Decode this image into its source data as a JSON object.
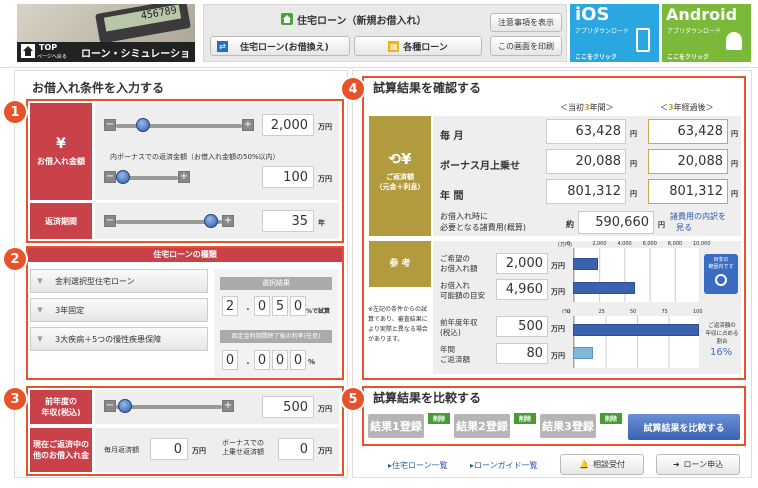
{
  "header": {
    "logo_top": "TOP",
    "logo_back": "ページへ戻る",
    "logo_title": "ローン・シミュレーション",
    "main_title": "住宅ローン（新規お借入れ）",
    "tab1": "住宅ローン(お借換え)",
    "tab2": "各種ローン",
    "btn_notes": "注意事項を表示",
    "btn_print": "この画面を印刷",
    "ios_title": "iOS",
    "ios_sub": "アプリダウンロード",
    "ios_click": "ここをクリック",
    "android_title": "Android",
    "android_sub": "アプリダウンロード",
    "android_click": "ここをクリック"
  },
  "left": {
    "title": "お借入れ条件を入力する",
    "yen": "¥",
    "loan_amount_label": "お借入れ金額",
    "loan_amount": "2,000",
    "unit_man": "万円",
    "bonus_note": "内ボーナスでの返済金額（お借入れ金額の50%以内）",
    "bonus_amount": "100",
    "term_label": "返済期間",
    "term": "35",
    "unit_year": "年",
    "loan_type_header": "住宅ローンの種類",
    "loan_types": [
      "金利選択型住宅ローン",
      "3年固定",
      "3大疾病＋5つの慢性疾患保障"
    ],
    "selected_header": "選択結果",
    "rate_digits": [
      "2",
      ".",
      "0",
      "5",
      "0"
    ],
    "rate_unit": "%で試算",
    "after_header": "固定金利期間終了後の利率(任意)",
    "after_digits": [
      "0",
      ".",
      "0",
      "0",
      "0"
    ],
    "after_unit": "%",
    "income_label1": "前年度の",
    "income_label2": "年収(税込)",
    "income": "500",
    "other_label1": "現在ご返済中の",
    "other_label2": "他のお借入れ金",
    "monthly_label": "毎月返済額",
    "monthly_val": "0",
    "bonus_pay_label1": "ボーナスでの",
    "bonus_pay_label2": "上乗せ返済額",
    "bonus_pay_val": "0"
  },
  "right": {
    "title": "試算結果を確認する",
    "col1_prefix": "＜当初",
    "col1_num": "3",
    "col1_suffix": "年間＞",
    "col2_prefix": "＜",
    "col2_num": "3",
    "col2_suffix": "年経過後＞",
    "gold_title1": "ご返済額",
    "gold_title2": "（元金＋利息）",
    "rows": [
      {
        "label": "毎 月",
        "v1": "63,428",
        "v2": "63,428"
      },
      {
        "label": "ボーナス月上乗せ",
        "v1": "20,088",
        "v2": "20,088"
      },
      {
        "label": "年 間",
        "v1": "801,312",
        "v2": "801,312"
      }
    ],
    "unit_yen": "円",
    "fee_label1": "お借入れ時に",
    "fee_label2": "必要となる諸費用(概算)",
    "fee_prefix": "約",
    "fee_val": "590,660",
    "fee_link1": "諸費用の内訳を",
    "fee_link2": "見る",
    "ref_label": "参 考",
    "ref_note": "※左記の条件からの試算であり、審査結果により実際と異なる場合があります。",
    "desired_label1": "ご希望の",
    "desired_label2": "お借入れ額",
    "desired_val": "2,000",
    "possible_label1": "お借入れ",
    "possible_label2": "可能額の目安",
    "possible_val": "4,960",
    "inc_label1": "前年度年収",
    "inc_label2": "(税込)",
    "inc_val": "500",
    "ann_label1": "年間",
    "ann_label2": "ご返済額",
    "ann_val": "80",
    "unit_man": "万円",
    "axis1_unit": "(万円)",
    "axis1_ticks": [
      "0",
      "2,000",
      "4,000",
      "6,000",
      "8,000",
      "10,000"
    ],
    "axis2_unit": "(%)",
    "axis2_ticks": [
      "0",
      "25",
      "50",
      "75",
      "100"
    ],
    "gauge_label1": "目安の",
    "gauge_label2": "範囲内です",
    "ratio_label1": "ご返済額の",
    "ratio_label2": "年収に占める",
    "ratio_label3": "割合",
    "ratio_val": "16%"
  },
  "chart_data": [
    {
      "type": "bar",
      "categories": [
        "ご希望のお借入れ額",
        "お借入れ可能額の目安"
      ],
      "values": [
        2000,
        4960
      ],
      "ylim": [
        0,
        10000
      ],
      "ylabel": "(万円)"
    },
    {
      "type": "bar",
      "categories": [
        "前年度年収(税込)",
        "年間ご返済額"
      ],
      "values": [
        100,
        16
      ],
      "ylim": [
        0,
        100
      ],
      "ylabel": "(%)"
    }
  ],
  "compare": {
    "title": "試算結果を比較する",
    "slots": [
      "結果1登録",
      "結果2登録",
      "結果3登録"
    ],
    "delete": "削除",
    "compare_btn": "試算結果を比較する"
  },
  "footer": {
    "link1": "住宅ローン一覧",
    "link2": "ローンガイド一覧",
    "btn_consult": "相談受付",
    "btn_apply": "ローン申込"
  },
  "badges": [
    "1",
    "2",
    "3",
    "4",
    "5"
  ],
  "colors": {
    "accent": "#e8522b",
    "label_red": "#c9424a",
    "gold": "#b29b3f",
    "ios": "#2aa6e0",
    "android": "#7ab93a",
    "bar_blue": "#3a62b0"
  }
}
